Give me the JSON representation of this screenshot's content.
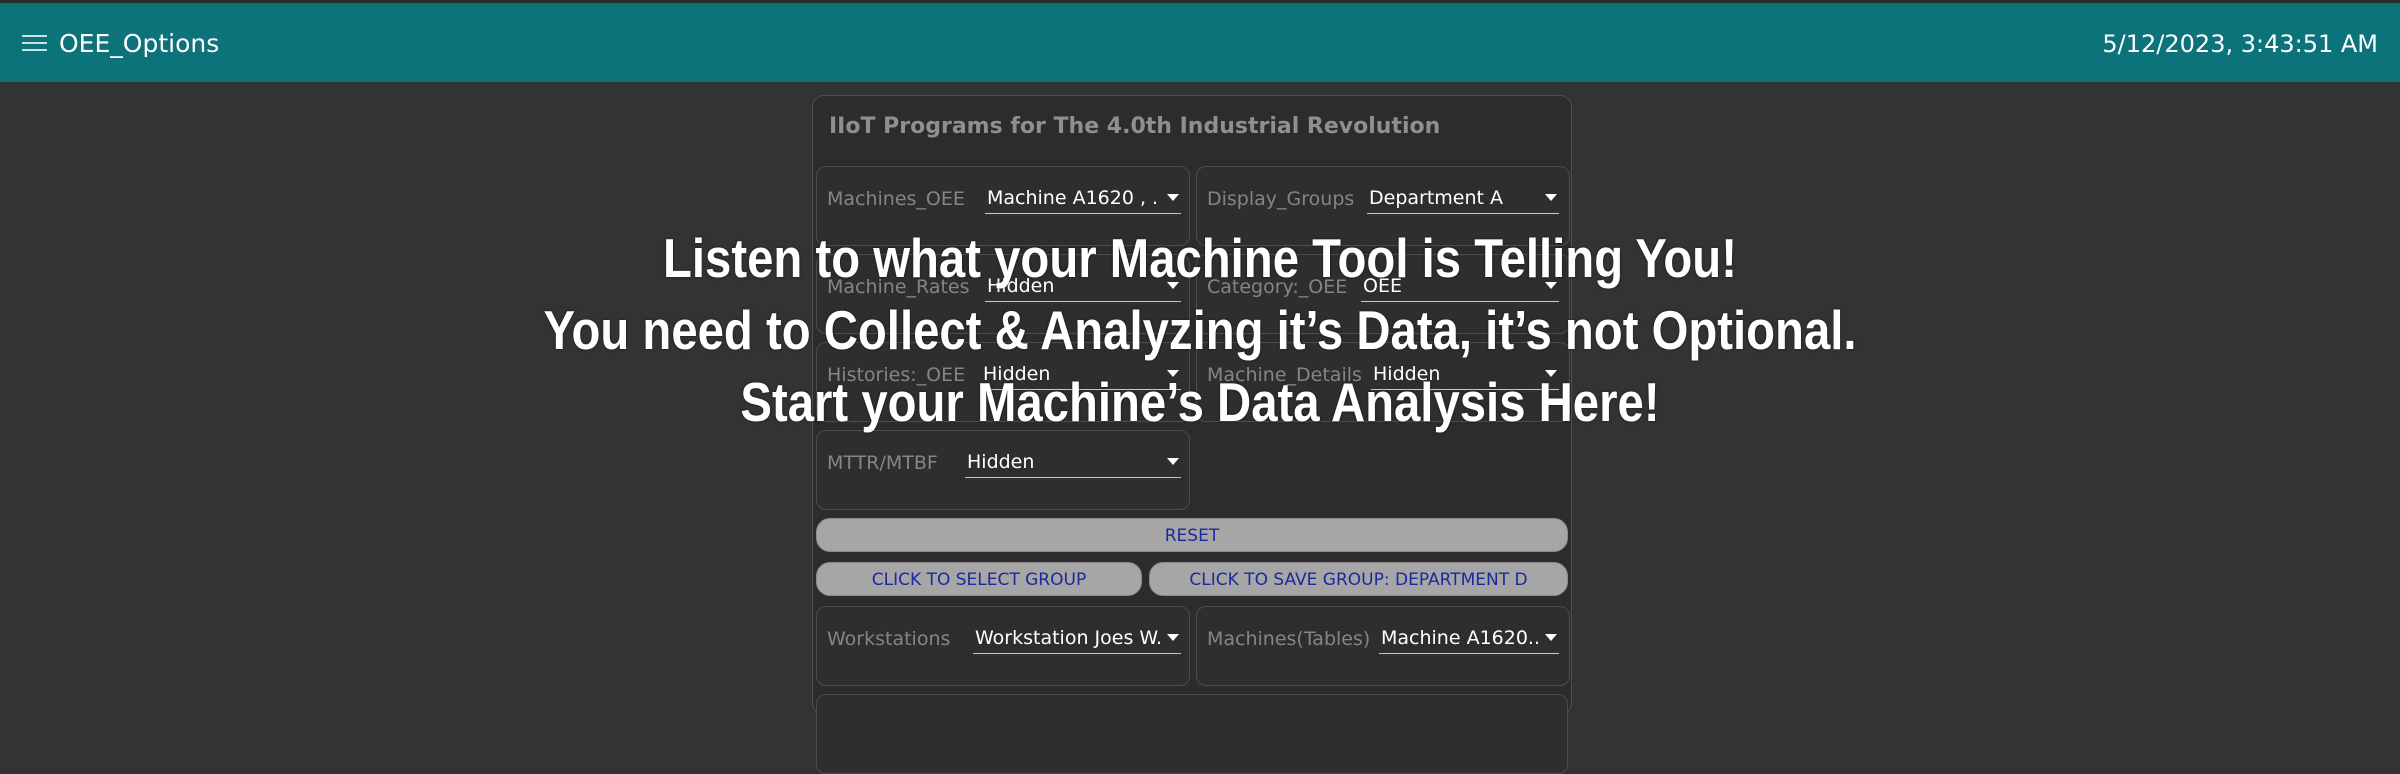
{
  "header": {
    "title": "OEE_Options",
    "datetime": "5/12/2023, 3:43:51 AM"
  },
  "panel": {
    "title": "IIoT Programs for The 4.0th Industrial Revolution",
    "rows": [
      {
        "label": "Machines_OEE",
        "value": "Machine A1620 , ..."
      },
      {
        "label": "Display_Groups",
        "value": "Department A"
      },
      {
        "label": "Machine_Rates",
        "value": "Hidden"
      },
      {
        "label": "Category:_OEE",
        "value": "OEE"
      },
      {
        "label": "Histories:_OEE",
        "value": "Hidden"
      },
      {
        "label": "Machine_Details",
        "value": "Hidden"
      },
      {
        "label": "MTTR/MTBF",
        "value": "Hidden"
      },
      {
        "label": "Workstations",
        "value": "Workstation Joes W..."
      },
      {
        "label": "Machines(Tables)",
        "value": "Machine A1620..."
      }
    ],
    "buttons": {
      "reset": "RESET",
      "select_group": "CLICK TO SELECT GROUP",
      "save_group": "CLICK TO SAVE GROUP: DEPARTMENT D"
    }
  },
  "overlay": {
    "line1": "Listen to what your Machine Tool is Telling You!",
    "line2": "You need to Collect & Analyzing it’s Data, it’s not Optional.",
    "line3": "Start your Machine’s Data Analysis Here!"
  },
  "colors": {
    "header_bg": "#0c737a",
    "page_bg": "#333333",
    "button_bg": "#a6a6a6",
    "button_text": "#1a2a9e"
  }
}
